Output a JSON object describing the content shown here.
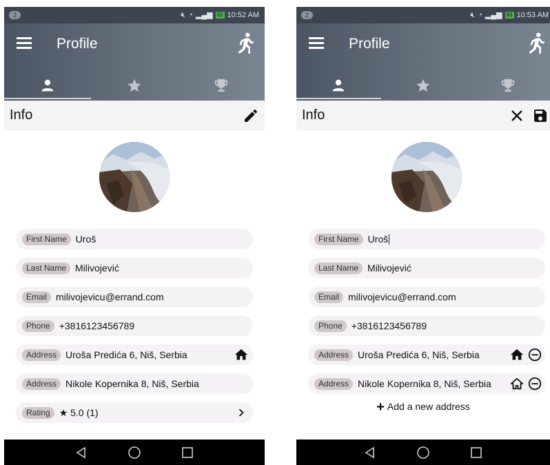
{
  "screens": [
    {
      "status": {
        "notification_count": "2",
        "time": "10:52 AM",
        "battery": "83"
      },
      "app": {
        "title": "Profile"
      },
      "section": {
        "title": "Info"
      },
      "fields": {
        "first_name": {
          "label": "First Name",
          "value": "Uroš"
        },
        "last_name": {
          "label": "Last Name",
          "value": "Milivojević"
        },
        "email": {
          "label": "Email",
          "value": "milivojevicu@errand.com"
        },
        "phone": {
          "label": "Phone",
          "value": "+3816123456789"
        },
        "address1": {
          "label": "Address",
          "value": "Uroša Predića 6, Niš, Serbia"
        },
        "address2": {
          "label": "Address",
          "value": "Nikole Kopernika 8, Niš, Serbia"
        },
        "rating": {
          "label": "Rating",
          "value": "★ 5.0 (1)"
        }
      }
    },
    {
      "status": {
        "notification_count": "2",
        "time": "10:53 AM",
        "battery": "83"
      },
      "app": {
        "title": "Profile"
      },
      "section": {
        "title": "Info"
      },
      "fields": {
        "first_name": {
          "label": "First Name",
          "value": "Uroš"
        },
        "last_name": {
          "label": "Last Name",
          "value": "Milivojević"
        },
        "email": {
          "label": "Email",
          "value": "milivojevicu@errand.com"
        },
        "phone": {
          "label": "Phone",
          "value": "+3816123456789"
        },
        "address1": {
          "label": "Address",
          "value": "Uroša Predića 6, Niš, Serbia"
        },
        "address2": {
          "label": "Address",
          "value": "Nikole Kopernika 8, Niš, Serbia"
        }
      },
      "add_address_label": "Add a new address"
    }
  ],
  "colors": {
    "appbar": "#5f6976",
    "statusbar": "#3d4550",
    "label_pill": "#cfc7c9",
    "field_bg": "#f4f2f5",
    "battery": "#4caf50"
  },
  "icons": [
    "menu-icon",
    "run-icon",
    "person-icon",
    "star-icon",
    "trophy-icon",
    "edit-icon",
    "close-icon",
    "save-icon",
    "home-icon",
    "home-outline-icon",
    "remove-circle-icon",
    "chevron-right-icon",
    "add-icon",
    "back-icon",
    "home-circle-icon",
    "recents-icon"
  ]
}
